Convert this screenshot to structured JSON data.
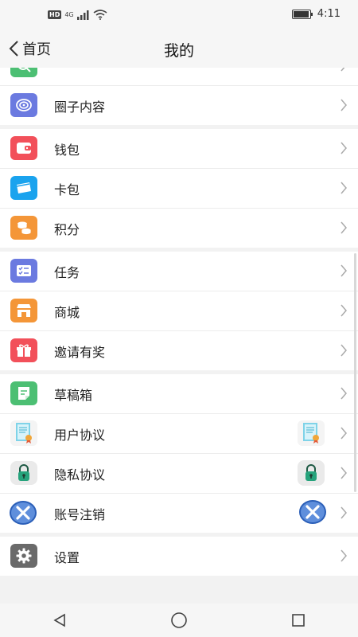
{
  "status": {
    "hd": "HD",
    "net": "4G",
    "time": "4:11",
    "battery_level": 0.95
  },
  "header": {
    "back_label": "首页",
    "title": "我的"
  },
  "colors": {
    "green": "#4cbf73",
    "purple": "#6b7ae0",
    "red": "#f2505a",
    "blue": "#1aa3ee",
    "orange": "#f49638",
    "grey": "#6a6a6a"
  },
  "groups": [
    {
      "items": [
        {
          "label": "",
          "icon": "search-icon"
        },
        {
          "label": "圈子内容",
          "icon": "circle-content-icon"
        }
      ]
    },
    {
      "items": [
        {
          "label": "钱包",
          "icon": "wallet-icon"
        },
        {
          "label": "卡包",
          "icon": "card-icon"
        },
        {
          "label": "积分",
          "icon": "points-icon"
        }
      ]
    },
    {
      "items": [
        {
          "label": "任务",
          "icon": "task-icon"
        },
        {
          "label": "商城",
          "icon": "shop-icon"
        },
        {
          "label": "邀请有奖",
          "icon": "gift-icon"
        }
      ]
    },
    {
      "items": [
        {
          "label": "草稿箱",
          "icon": "draft-icon"
        },
        {
          "label": "用户协议",
          "icon": "document-certificate-icon"
        },
        {
          "label": "隐私协议",
          "icon": "lock-icon"
        },
        {
          "label": "账号注销",
          "icon": "close-circle-icon"
        }
      ]
    },
    {
      "items": [
        {
          "label": "设置",
          "icon": "gear-icon"
        }
      ]
    }
  ]
}
